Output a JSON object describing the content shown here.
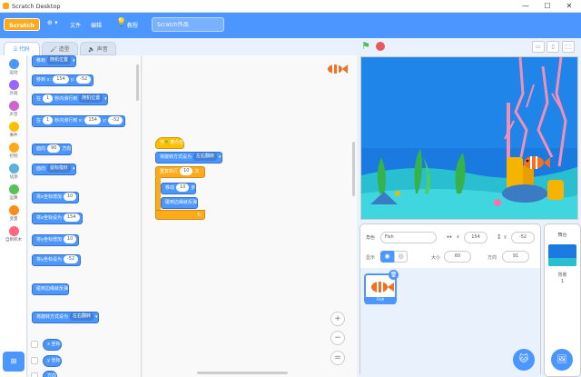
{
  "window": {
    "title": "Scratch Desktop",
    "minimize": "—",
    "maximize": "☐",
    "close": "✕"
  },
  "menu": {
    "logo": "Scratch",
    "globe": "⊕ ▾",
    "file": "文件",
    "edit": "编辑",
    "tutorials": "教程",
    "project_name": "Scratch作品"
  },
  "tabs": {
    "code": "代码",
    "costumes": "造型",
    "sounds": "声音"
  },
  "categories": [
    {
      "label": "运动",
      "color": "#4c97ff"
    },
    {
      "label": "外观",
      "color": "#9966ff"
    },
    {
      "label": "声音",
      "color": "#cf63cf"
    },
    {
      "label": "事件",
      "color": "#ffbf00"
    },
    {
      "label": "控制",
      "color": "#ffab19"
    },
    {
      "label": "侦测",
      "color": "#5cb1d6"
    },
    {
      "label": "运算",
      "color": "#59c059"
    },
    {
      "label": "变量",
      "color": "#ff8c1a"
    },
    {
      "label": "自制积木",
      "color": "#ff6680"
    }
  ],
  "palette": {
    "b1": "移到",
    "b1_dd": "随机位置",
    "b2": "移到 x:",
    "b2_x": "154",
    "b2_y_lbl": "y:",
    "b2_y": "-52",
    "b3": "在",
    "b3_v": "1",
    "b3_mid": "秒内滑行到",
    "b3_dd": "随机位置",
    "b4": "在",
    "b4_v": "1",
    "b4_mid": "秒内滑行到 x:",
    "b4_x": "154",
    "b4_y_lbl": "y:",
    "b4_y": "-52",
    "b5": "面向",
    "b5_v": "90",
    "b5_end": "方向",
    "b6": "面向",
    "b6_dd": "鼠标指针",
    "b7": "将x坐标增加",
    "b7_v": "10",
    "b8": "将x坐标设为",
    "b8_v": "154",
    "b9": "将y坐标增加",
    "b9_v": "10",
    "b10": "将y坐标设为",
    "b10_v": "-52",
    "b11": "碰到边缘就反弹",
    "b12": "将旋转方式设为",
    "b12_dd": "左右翻转",
    "r1": "x 坐标",
    "r2": "y 坐标",
    "r3": "方向"
  },
  "script": {
    "hat": "当",
    "hat_end": "被点击",
    "set_rot": "将旋转方式设为",
    "set_rot_dd": "左右翻转",
    "repeat": "重复执行",
    "repeat_v": "10",
    "repeat_end": "次",
    "move": "移动",
    "move_v": "10",
    "move_end": "步",
    "bounce": "碰到边缘就反弹"
  },
  "zoom": {
    "in": "+",
    "out": "−",
    "reset": "="
  },
  "sprite": {
    "label": "角色",
    "name": "Fish",
    "x_lbl": "x",
    "x": "154",
    "y_lbl": "y",
    "y": "-52",
    "show_lbl": "显示",
    "size_lbl": "大小",
    "size": "60",
    "dir_lbl": "方向",
    "dir": "91",
    "thumb_name": "Fish"
  },
  "stage_panel": {
    "title": "舞台",
    "backdrops_lbl": "背景",
    "backdrops_count": "1"
  },
  "colors": {
    "accent": "#4c97ff",
    "motion": "#4c97ff",
    "control": "#ffab19",
    "events": "#ffbf00"
  }
}
